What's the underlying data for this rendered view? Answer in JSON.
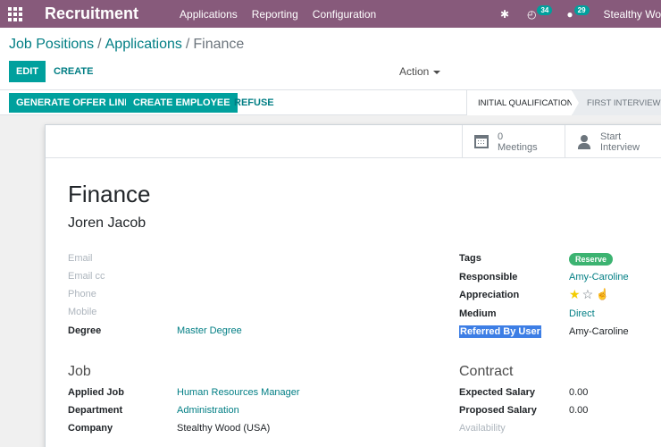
{
  "navbar": {
    "brand": "Recruitment",
    "menu": [
      "Applications",
      "Reporting",
      "Configuration"
    ],
    "activity_count": "34",
    "message_count": "29",
    "user": "Stealthy Wood"
  },
  "control_panel": {
    "breadcrumb": [
      "Job Positions",
      "Applications",
      "Finance"
    ],
    "edit_label": "EDIT",
    "create_label": "CREATE",
    "action_label": "Action"
  },
  "statusbar": {
    "buttons": [
      "GENERATE OFFER LINK",
      "CREATE EMPLOYEE",
      "REFUSE"
    ],
    "stages": [
      "INITIAL QUALIFICATION",
      "FIRST INTERVIEW"
    ]
  },
  "smart_buttons": {
    "meetings_count": "0",
    "meetings_label": "Meetings",
    "start_label": "Start",
    "interview_label": "Interview"
  },
  "form": {
    "title": "Finance",
    "partner_name": "Joren Jacob",
    "left_fields": [
      {
        "label": "Email",
        "value": ""
      },
      {
        "label": "Email cc",
        "value": ""
      },
      {
        "label": "Phone",
        "value": ""
      },
      {
        "label": "Mobile",
        "value": ""
      },
      {
        "label": "Degree",
        "value": "Master Degree"
      }
    ],
    "right_fields": {
      "tags_label": "Tags",
      "tag_value": "Reserve",
      "responsible_label": "Responsible",
      "responsible_value": "Amy-Caroline",
      "appreciation_label": "Appreciation",
      "appreciation_stars": 1,
      "appreciation_max": 3,
      "medium_label": "Medium",
      "medium_value": "Direct",
      "referred_label": "Referred By User",
      "referred_value": "Amy-Caroline"
    },
    "job_section": {
      "title": "Job",
      "applied_job_label": "Applied Job",
      "applied_job_value": "Human Resources Manager",
      "department_label": "Department",
      "department_value": "Administration",
      "company_label": "Company",
      "company_value": "Stealthy Wood (USA)"
    },
    "contract_section": {
      "title": "Contract",
      "expected_salary_label": "Expected Salary",
      "expected_salary_value": "0.00",
      "proposed_salary_label": "Proposed Salary",
      "proposed_salary_value": "0.00",
      "availability_label": "Availability"
    }
  },
  "colors": {
    "navbar": "#875a7b",
    "primary": "#00a09d",
    "link": "#017e84",
    "tag": "#3cb371",
    "star": "#f3cc00"
  }
}
